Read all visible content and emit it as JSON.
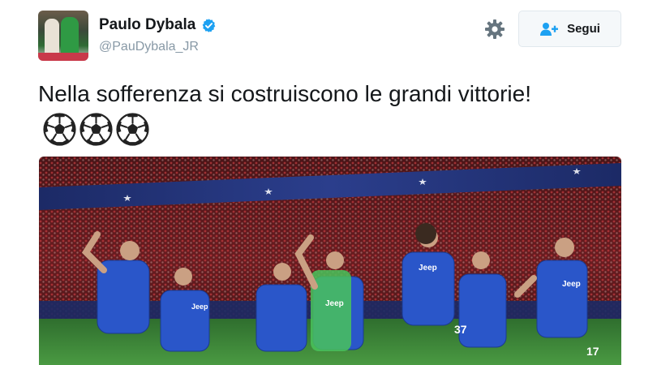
{
  "user": {
    "display_name": "Paulo Dybala",
    "handle": "@PauDybala_JR",
    "verified": true
  },
  "actions": {
    "settings_icon": "gear-icon",
    "follow_label": "Segui",
    "follow_icon": "follow-user-icon"
  },
  "tweet": {
    "text": "Nella sofferenza si costruiscono le grandi vittorie!",
    "emoji": [
      "soccer-ball-icon",
      "soccer-ball-icon",
      "soccer-ball-icon"
    ]
  },
  "media": {
    "jersey_sponsor": "Jeep",
    "shirt_numbers": [
      "37",
      "17"
    ]
  },
  "colors": {
    "accent": "#1da1f2",
    "handle_gray": "#8899a6",
    "kit_blue": "#2a56c9",
    "pitch_green": "#3d8a3a"
  }
}
